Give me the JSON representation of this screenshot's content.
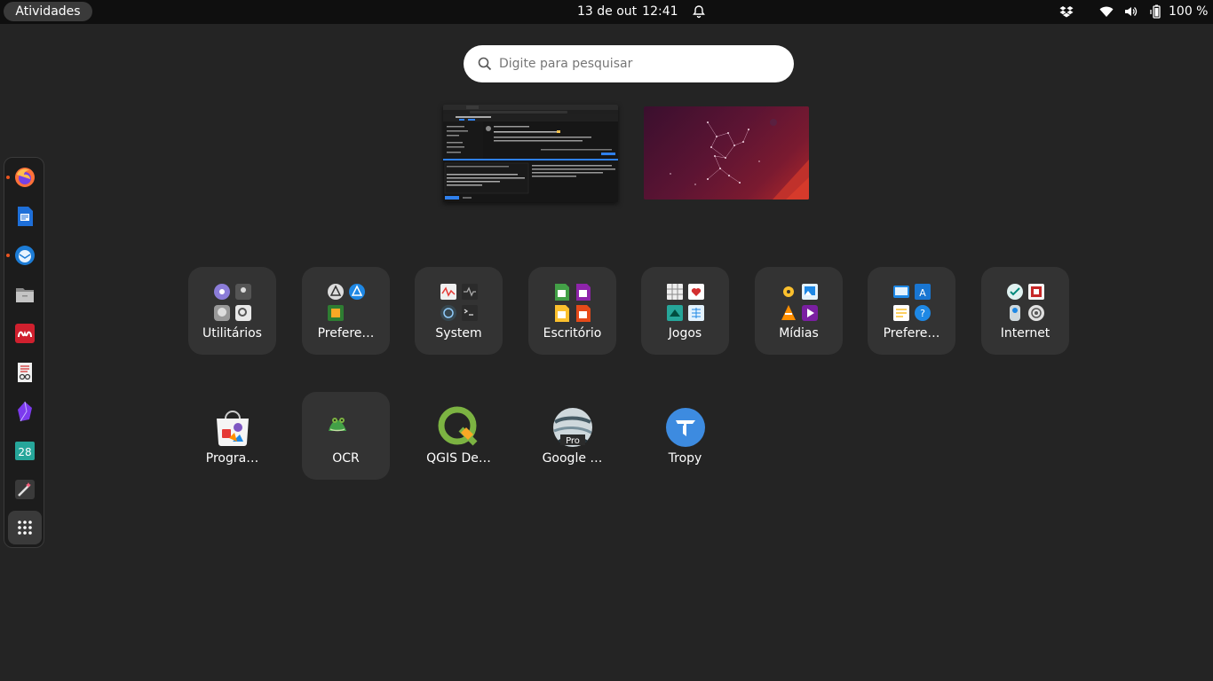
{
  "topbar": {
    "activities_label": "Atividades",
    "date": "13 de out",
    "time": "12:41",
    "battery": "100 %"
  },
  "search": {
    "placeholder": "Digite para pesquisar"
  },
  "workspaces": [
    {
      "name": "workspace-1"
    },
    {
      "name": "workspace-2"
    }
  ],
  "dock": {
    "items": [
      {
        "icon": "firefox-icon",
        "running": true
      },
      {
        "icon": "libreoffice-writer-icon",
        "running": false
      },
      {
        "icon": "thunderbird-icon",
        "running": true
      },
      {
        "icon": "files-icon",
        "running": false
      },
      {
        "icon": "mendeley-icon",
        "running": false
      },
      {
        "icon": "document-viewer-icon",
        "running": false
      },
      {
        "icon": "obsidian-icon",
        "running": false
      },
      {
        "icon": "calendar-icon",
        "running": false
      },
      {
        "icon": "magic-wand-icon",
        "running": false
      },
      {
        "icon": "show-apps-icon",
        "running": false
      }
    ],
    "calendar_day": "28"
  },
  "folders": [
    {
      "label": "Utilitários"
    },
    {
      "label": "Prefere…"
    },
    {
      "label": "System"
    },
    {
      "label": "Escritório"
    },
    {
      "label": "Jogos"
    },
    {
      "label": "Mídias"
    },
    {
      "label": "Prefere…"
    },
    {
      "label": "Internet"
    }
  ],
  "apps": [
    {
      "label": "Progra…",
      "icon": "software-center-icon"
    },
    {
      "label": "OCR",
      "icon": "ocr-frog-icon"
    },
    {
      "label": "QGIS De…",
      "icon": "qgis-icon"
    },
    {
      "label": "Google …",
      "icon": "google-earth-pro-icon",
      "badge": "Pro"
    },
    {
      "label": "Tropy",
      "icon": "tropy-icon"
    }
  ],
  "colors": {
    "background": "#242424",
    "topbar": "#0f0f0f",
    "folder_bg": "#333333",
    "accent": "#e95420"
  }
}
